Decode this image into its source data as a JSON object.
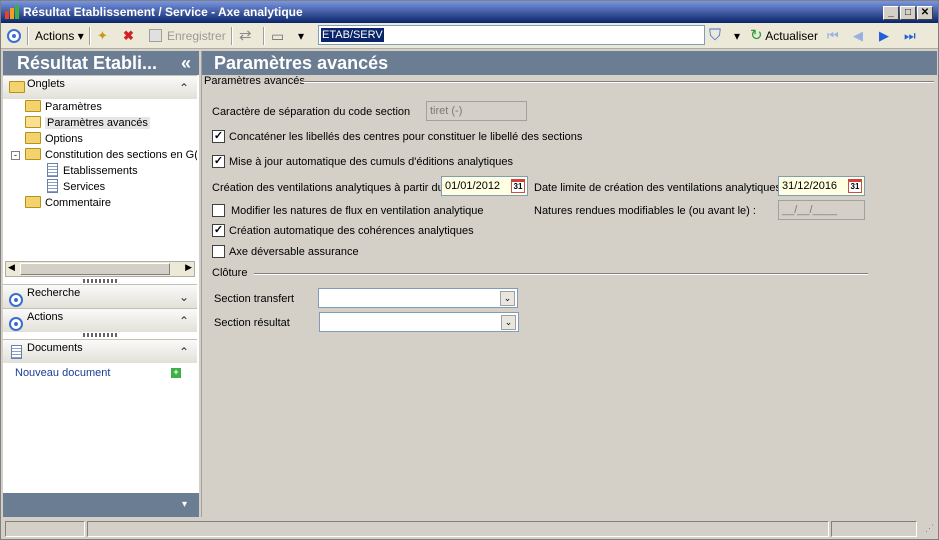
{
  "window": {
    "title": "Résultat Etablissement / Service -  Axe analytique"
  },
  "toolbar": {
    "actions_label": "Actions",
    "save_label": "Enregistrer",
    "combo_value": "ETAB/SERV",
    "refresh_label": "Actualiser"
  },
  "left_panel": {
    "header": "Résultat Etabli...",
    "collapse_glyph": "«",
    "onglets_title": "Onglets",
    "tree": [
      "Paramètres",
      "Paramètres avancés",
      "Options",
      "Constitution des sections en G(",
      "Etablissements",
      "Services",
      "Commentaire"
    ],
    "recherche_title": "Recherche",
    "actions_title": "Actions",
    "documents_title": "Documents",
    "new_document_link": "Nouveau document"
  },
  "main": {
    "header": "Paramètres avancés",
    "group_title": "Paramètres avancés",
    "separator_label": "Caractère de séparation du code section",
    "separator_value": "tiret (-)",
    "concat_label": "Concaténer les libellés des centres pour constituer le libellé des sections",
    "concat_checked": true,
    "update_label": "Mise à jour automatique des cumuls d'éditions analytiques",
    "update_checked": true,
    "creation_date_label": "Création des ventilations analytiques à partir du",
    "creation_date_value": "01/01/2012",
    "limit_date_label": "Date limite de création des ventilations analytiques",
    "limit_date_value": "31/12/2016",
    "calendar_day": "31",
    "modify_flux_label": "Modifier les natures de flux en ventilation analytique",
    "modify_flux_checked": false,
    "natures_label": "Natures rendues modifiables le (ou avant le) :",
    "natures_value": "__/__/____",
    "auto_coherence_label": "Création automatique des cohérences analytiques",
    "auto_coherence_checked": true,
    "axe_assurance_label": "Axe déversable assurance",
    "axe_assurance_checked": false,
    "cloture_title": "Clôture",
    "transfer_label": "Section transfert",
    "transfer_value": "",
    "result_label": "Section résultat",
    "result_value": ""
  },
  "colors": {
    "title_gradient_start": "#7a96df",
    "title_gradient_end": "#0a246a",
    "panel_header": "#6b7d93",
    "selection": "#0a246a",
    "date_field_bg": "#ffffe1"
  }
}
